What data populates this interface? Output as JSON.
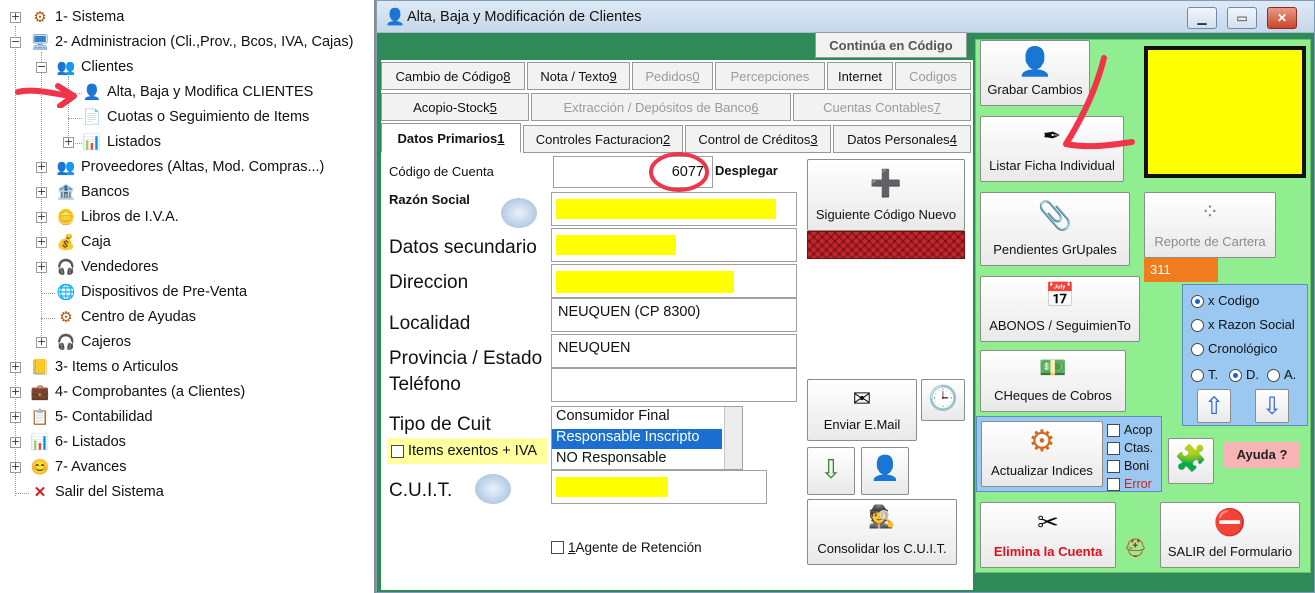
{
  "tree": {
    "sistema": "1- Sistema",
    "administracion": "2- Administracion (Cli.,Prov., Bcos, IVA, Cajas)",
    "clientes": "Clientes",
    "alta_baja": "Alta, Baja y Modifica CLIENTES",
    "cuotas": "Cuotas o Seguimiento de Items",
    "listados": "Listados",
    "proveedores": "Proveedores (Altas, Mod. Compras...)",
    "bancos": "Bancos",
    "libros_iva": "Libros de I.V.A.",
    "caja": "Caja",
    "vendedores": "Vendedores",
    "dispositivos": "Dispositivos de Pre-Venta",
    "centro_ayudas": "Centro de Ayudas",
    "cajeros": "Cajeros",
    "items": "3- Items o Articulos",
    "comprobantes": "4- Comprobantes (a Clientes)",
    "contabilidad": "5- Contabilidad",
    "listados6": "6- Listados",
    "avances": "7- Avances",
    "salir": "Salir del Sistema"
  },
  "window": {
    "title": "Alta, Baja y Modificación de Clientes",
    "minimize": "▁",
    "maximize": "▭",
    "close": "✕"
  },
  "tabs": {
    "continua": "Continúa en Código",
    "row1": [
      {
        "label": "Cambio de Código ",
        "key": "8"
      },
      {
        "label": "Nota / Texto ",
        "key": "9"
      },
      {
        "label": "Pedidos ",
        "key": "0"
      },
      {
        "label": "Percepciones",
        "key": ""
      },
      {
        "label": "Internet",
        "key": ""
      },
      {
        "label": "Codigos",
        "key": ""
      }
    ],
    "row2": [
      {
        "label": "Acopio-Stock ",
        "key": "5"
      },
      {
        "label": "Extracción / Depósitos de Banco ",
        "key": "6"
      },
      {
        "label": "Cuentas Contables ",
        "key": "7"
      }
    ],
    "row3": [
      {
        "label": "Datos Primarios ",
        "key": "1"
      },
      {
        "label": "Controles Facturacion ",
        "key": "2"
      },
      {
        "label": "Control de Créditos ",
        "key": "3"
      },
      {
        "label": "Datos Personales ",
        "key": "4"
      }
    ]
  },
  "form": {
    "codigo_label": "Código de Cuenta",
    "codigo_value": "6077",
    "desplegar": "Desplegar",
    "razon_label": "Razón Social",
    "secundario_label": "Datos secundario",
    "direccion_label": "Direccion",
    "localidad_label": "Localidad",
    "localidad_value": "NEUQUEN (CP 8300)",
    "provincia_label": "Provincia / Estado",
    "provincia_value": "NEUQUEN",
    "telefono_label": "Teléfono",
    "tipo_cuit_label": "Tipo de Cuit",
    "cuit_options": [
      "Consumidor Final",
      "Responsable Inscripto",
      "NO Responsable"
    ],
    "cuit_selected": "Responsable Inscripto",
    "items_exentos": "Items exentos + IVA",
    "cuit_label": "C.U.I.T.",
    "agente_key": "1",
    "agente_label": " Agente de Retención"
  },
  "buttons": {
    "siguiente": "Siguiente Código Nuevo",
    "enviar_email": "Enviar E.Mail",
    "consolidar": "Consolidar los C.U.I.T.",
    "grabar": "Grabar Cambios",
    "listar_ficha": "Listar Ficha Individual",
    "pendientes": "Pendientes GrUpales",
    "reporte": "Reporte de Cartera",
    "reporte_count": "311",
    "abonos": "ABONOS / SeguimienTo",
    "cheques": "CHeques de Cobros",
    "actualizar": "Actualizar Indices",
    "ayuda": "Ayuda ?",
    "elimina": "Elimina la Cuenta",
    "salir_form": "SALIR del Formulario"
  },
  "order": {
    "x_codigo": "x Codigo",
    "x_razon": "x Razon Social",
    "cronologico": "Cronológico",
    "t": "T.",
    "d": "D.",
    "a": "A."
  },
  "checks": {
    "acop": "Acop",
    "ctas": "Ctas.",
    "boni": "Boni",
    "error": "Error"
  },
  "colors": {
    "green": "#2e8b57",
    "lightgreen": "#90ee90",
    "yellow": "#ffff00",
    "selection": "#1a6fd0",
    "annotation_red": "#f0344a"
  }
}
